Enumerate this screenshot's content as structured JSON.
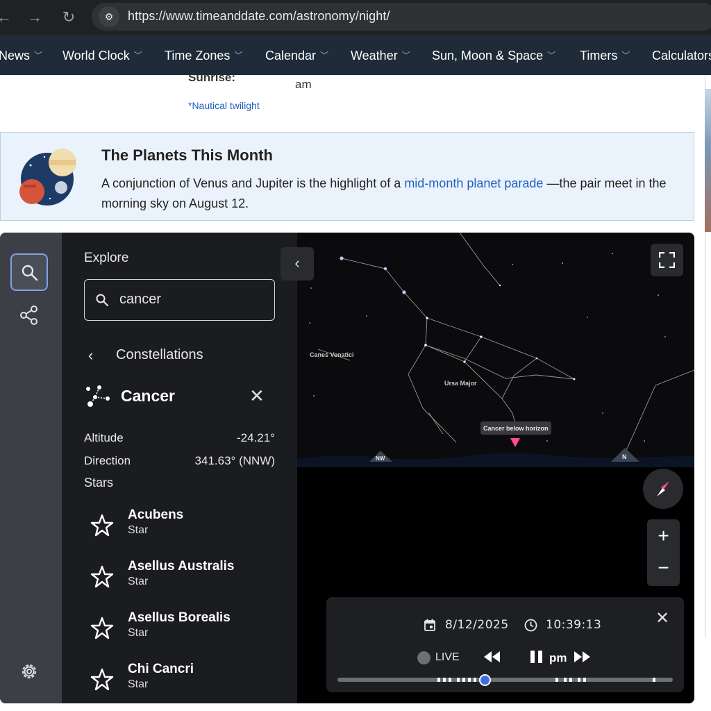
{
  "browser": {
    "url": "https://www.timeanddate.com/astronomy/night/",
    "back_glyph": "←",
    "forward_glyph": "→",
    "reload_glyph": "↻",
    "site_info_glyph": "⚙"
  },
  "site_nav": {
    "items": [
      {
        "label": "News"
      },
      {
        "label": "World Clock"
      },
      {
        "label": "Time Zones"
      },
      {
        "label": "Calendar"
      },
      {
        "label": "Weather"
      },
      {
        "label": "Sun, Moon & Space"
      },
      {
        "label": "Timers"
      },
      {
        "label": "Calculators"
      }
    ],
    "chevron": "﹀"
  },
  "sun_info": {
    "sunrise_label": "Sunrise:",
    "sunrise_value": "am",
    "twilight_link": "*Nautical twilight"
  },
  "planets": {
    "title": "The Planets This Month",
    "text_before": "A conjunction of Venus and Jupiter is the highlight of a ",
    "link": "mid-month planet parade",
    "text_after": " —the pair meet in the morning sky on August 12."
  },
  "explore": {
    "title": "Explore",
    "search_value": "cancer",
    "back_glyph": "‹",
    "category": "Constellations",
    "object_name": "Cancer",
    "close_glyph": "✕",
    "properties": [
      {
        "label": "Altitude",
        "value": "-24.21°"
      },
      {
        "label": "Direction",
        "value": "341.63° (NNW)"
      }
    ],
    "stars_heading": "Stars",
    "stars": [
      {
        "name": "Acubens",
        "type": "Star"
      },
      {
        "name": "Asellus Australis",
        "type": "Star"
      },
      {
        "name": "Asellus Borealis",
        "type": "Star"
      },
      {
        "name": "Chi Cancri",
        "type": "Star"
      }
    ]
  },
  "sky": {
    "collapse_glyph": "‹",
    "labels": {
      "canes_venatici": "Canes Venatici",
      "ursa_major": "Ursa Major",
      "cancer_tooltip": "Cancer below horizon",
      "nw": "NW",
      "n": "N"
    },
    "zoom_in": "+",
    "zoom_out": "−",
    "colors": {
      "accent": "#ff4d8d",
      "ground": "#0b1424",
      "constellation_lines": "#9a9a9a"
    }
  },
  "time_control": {
    "date": "8/12/2025",
    "time": "10:39:13",
    "close_glyph": "✕",
    "live_label": "LIVE",
    "ampm": "pm",
    "timeline_position": 0.44
  }
}
